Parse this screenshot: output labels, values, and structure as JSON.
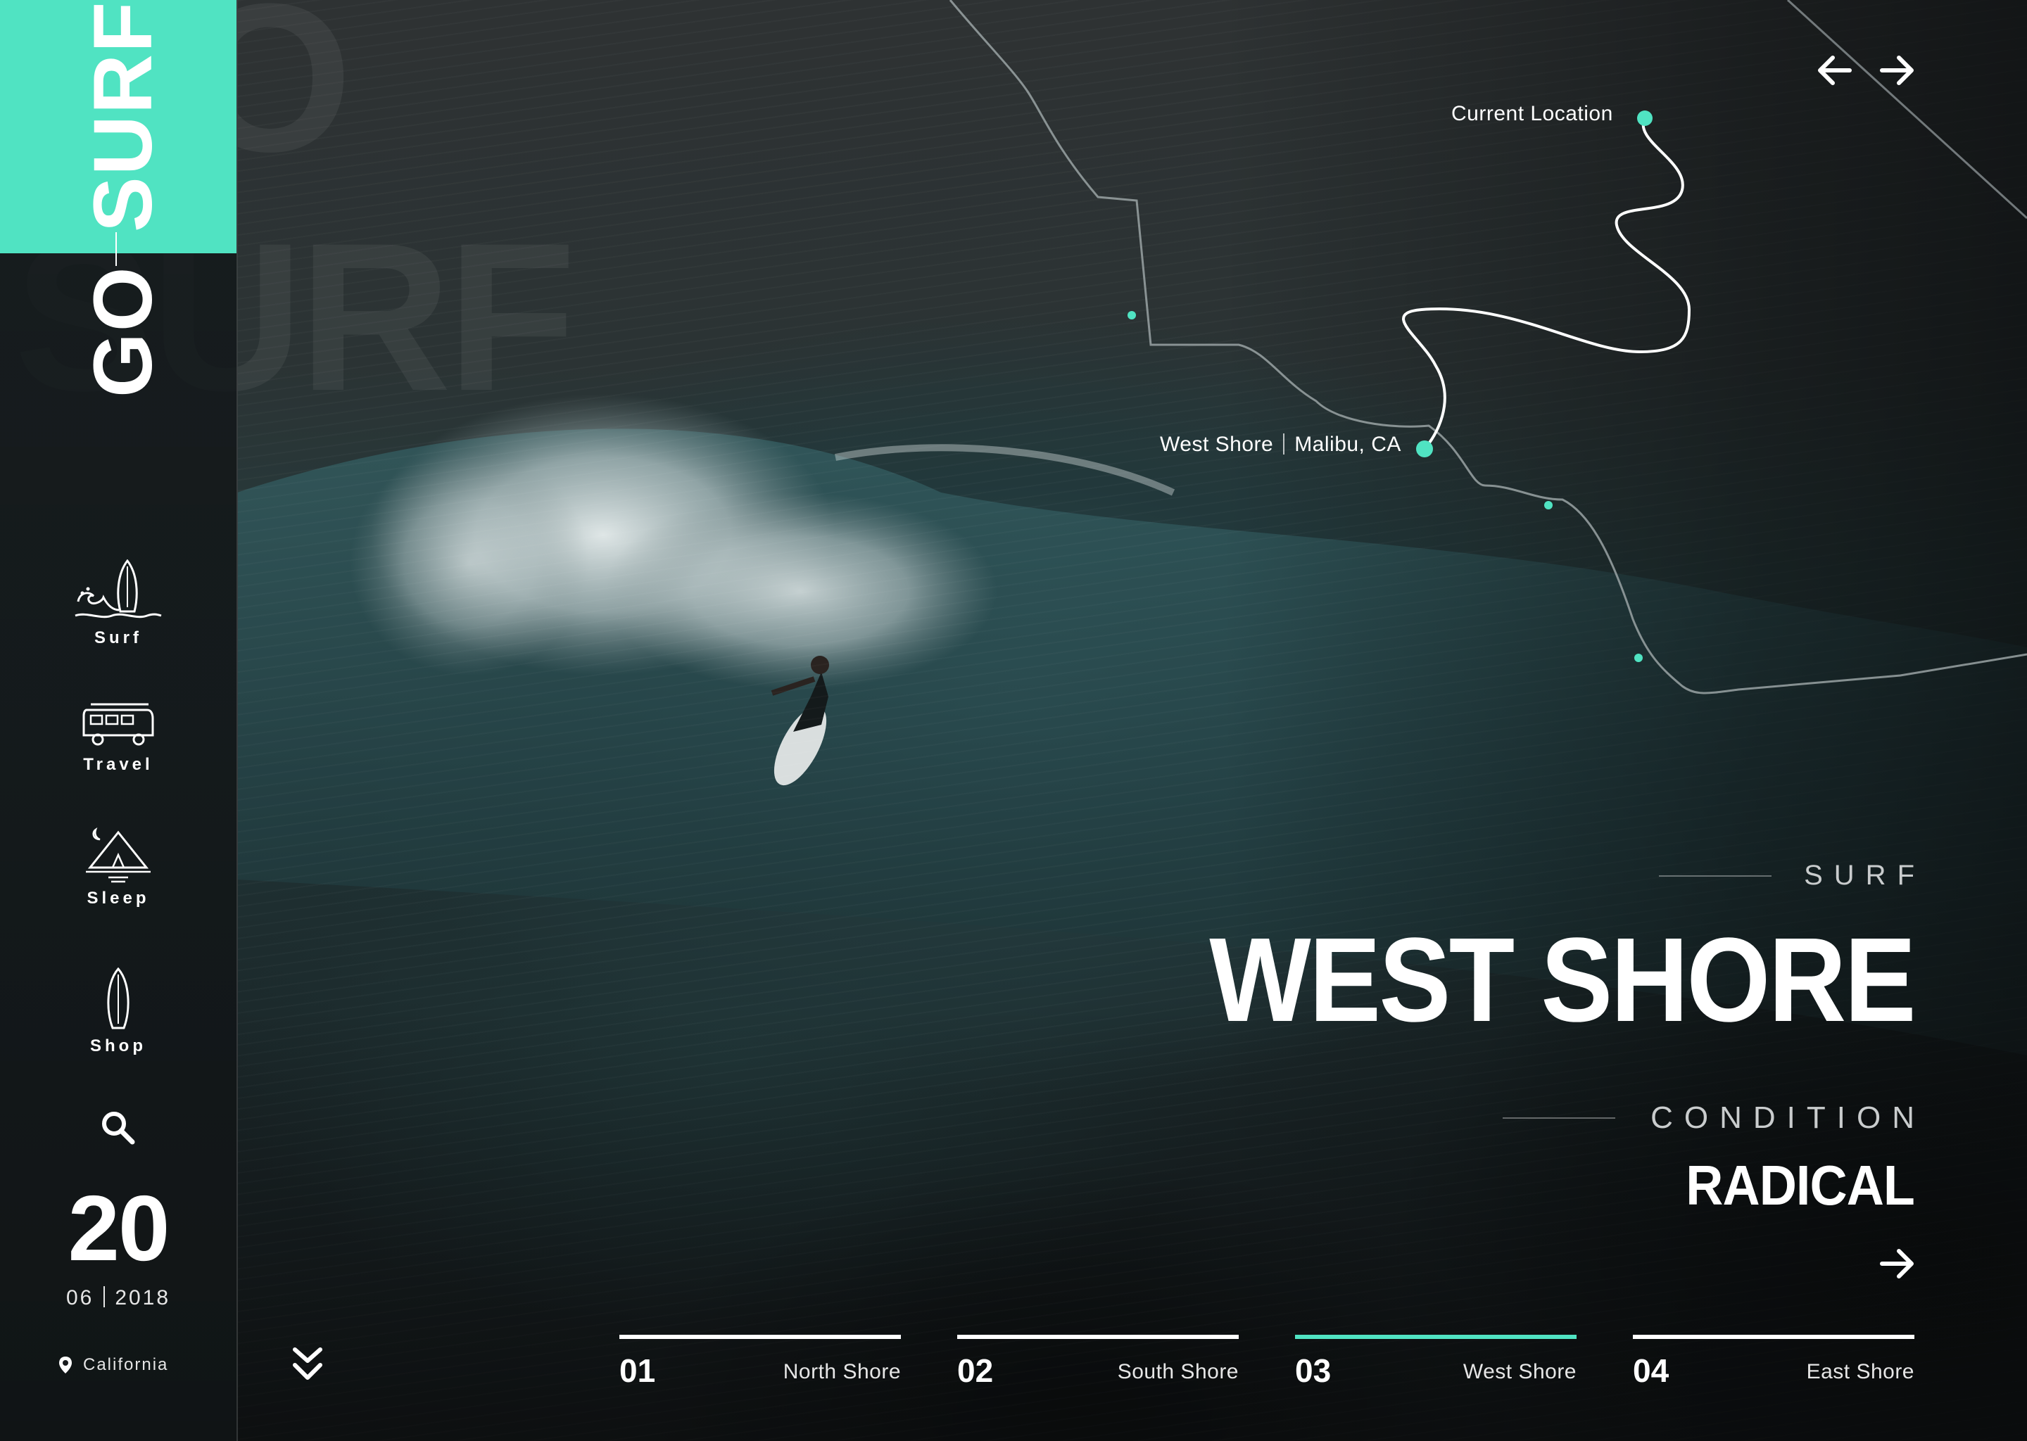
{
  "brand": {
    "go": "GO",
    "surf": "SURF",
    "ghost_go": "GO",
    "ghost_surf": "SURF"
  },
  "sidebar": {
    "items": [
      {
        "label": "Surf",
        "icon": "surfboard-wave-icon"
      },
      {
        "label": "Travel",
        "icon": "van-icon"
      },
      {
        "label": "Sleep",
        "icon": "tent-icon"
      },
      {
        "label": "Shop",
        "icon": "surfboard-icon"
      }
    ],
    "search_icon": "search-icon",
    "date": {
      "day": "20",
      "month": "06",
      "year": "2018"
    },
    "location": "California",
    "location_icon": "map-pin-icon",
    "scroll_icon": "double-chevron-down-icon"
  },
  "map": {
    "current_location_label": "Current Location",
    "spot_name": "West Shore",
    "spot_place": "Malibu, CA"
  },
  "nav_arrows": {
    "prev_icon": "arrow-left-icon",
    "next_icon": "arrow-right-icon"
  },
  "headline": {
    "subtitle": "SURF",
    "title": "WEST SHORE",
    "condition_label": "CONDITION",
    "condition_value": "RADICAL",
    "action_icon": "arrow-right-icon"
  },
  "tabs": [
    {
      "number": "01",
      "name": "North Shore",
      "active": false
    },
    {
      "number": "02",
      "name": "South Shore",
      "active": false
    },
    {
      "number": "03",
      "name": "West Shore",
      "active": true
    },
    {
      "number": "04",
      "name": "East Shore",
      "active": false
    }
  ],
  "colors": {
    "accent": "#50e3c2",
    "background": "#171a1c",
    "text": "#ffffff"
  }
}
